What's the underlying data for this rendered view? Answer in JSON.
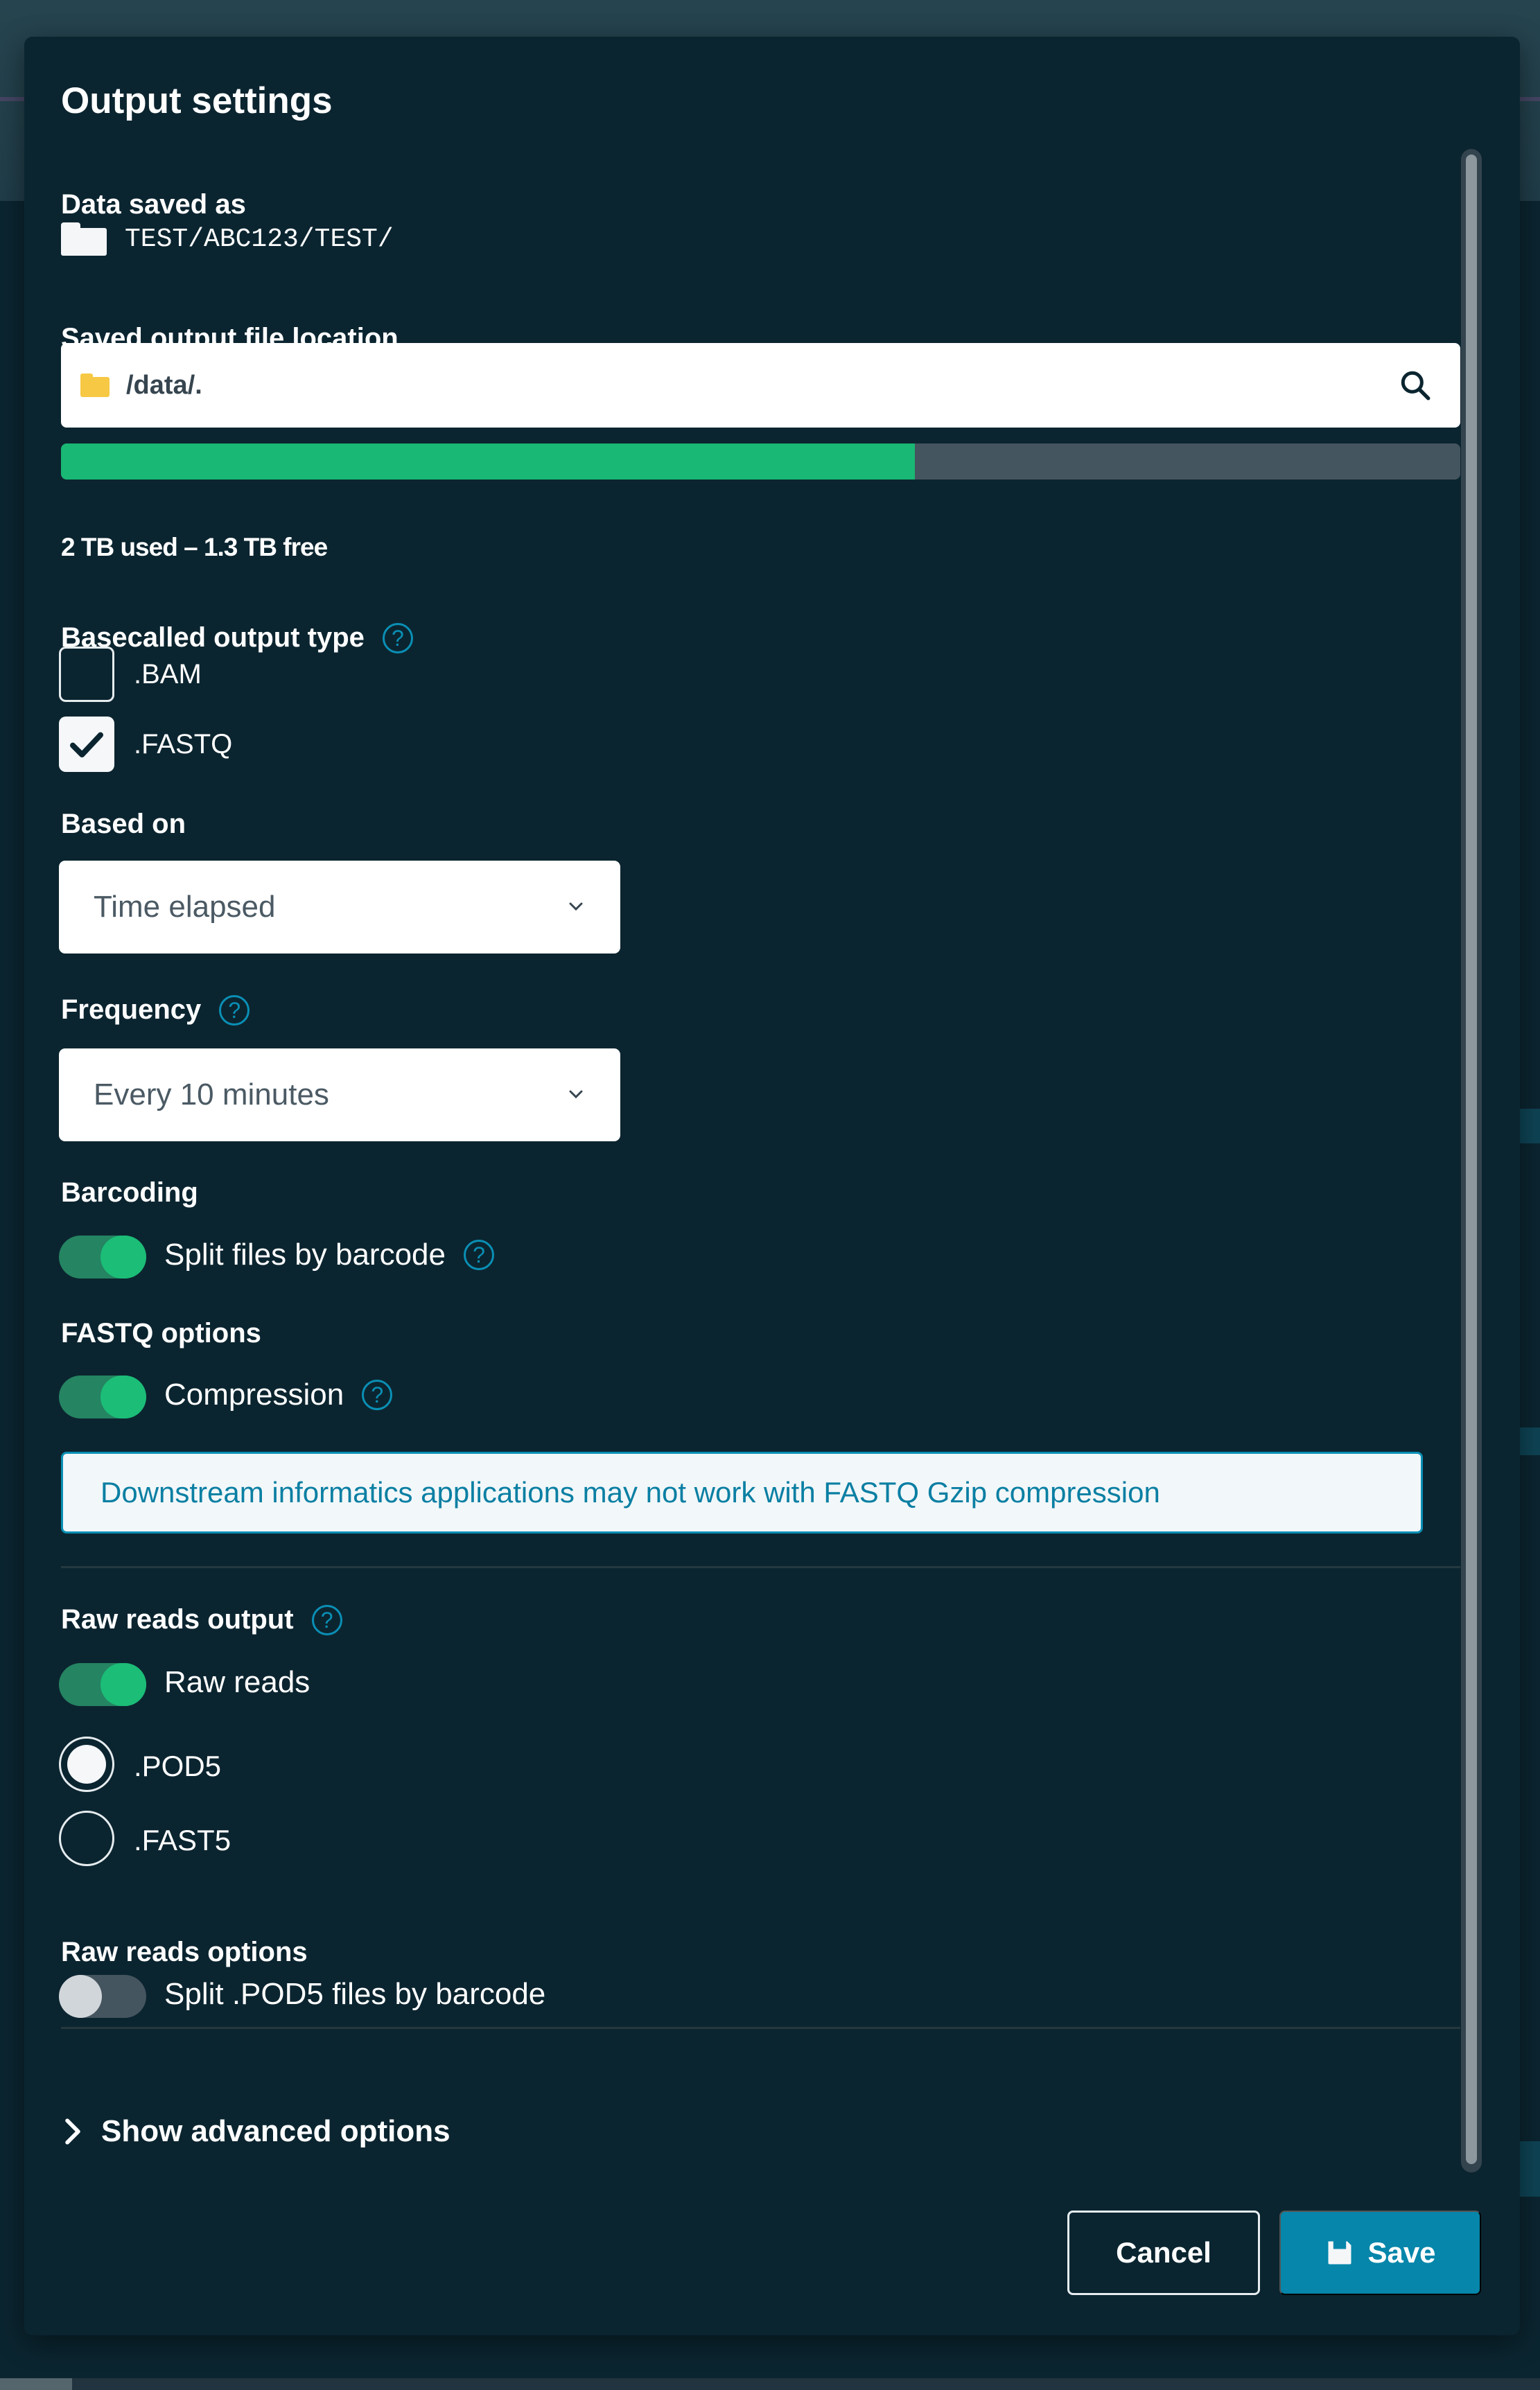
{
  "dialog": {
    "title": "Output settings"
  },
  "data_saved_as": {
    "label": "Data saved as",
    "icon": "folder-icon",
    "value": "TEST/ABC123/TEST/"
  },
  "file_location": {
    "label": "Saved output file location",
    "icon": "folder-icon",
    "value": "/data/.",
    "search_icon": "search-icon",
    "storage_used_fraction": 0.61,
    "usage_text": "2 TB used – 1.3 TB free",
    "colors": {
      "used": "#19b874",
      "free": "#45555f"
    }
  },
  "basecalled_output": {
    "label": "Basecalled output type",
    "help": "?",
    "options": [
      {
        "label": ".BAM",
        "checked": false
      },
      {
        "label": ".FASTQ",
        "checked": true
      }
    ]
  },
  "based_on": {
    "label": "Based on",
    "selected": "Time elapsed"
  },
  "frequency": {
    "label": "Frequency",
    "help": "?",
    "selected": "Every 10 minutes"
  },
  "barcoding": {
    "label": "Barcoding",
    "toggle_label": "Split files by barcode",
    "enabled": true,
    "help": "?"
  },
  "fastq_options": {
    "label": "FASTQ options",
    "toggle_label": "Compression",
    "enabled": true,
    "help": "?",
    "info_message": "Downstream informatics applications may not work with FASTQ Gzip compression"
  },
  "raw_reads_output": {
    "label": "Raw reads output",
    "help": "?",
    "toggle_label": "Raw reads",
    "enabled": true,
    "formats": [
      {
        "label": ".POD5",
        "selected": true
      },
      {
        "label": ".FAST5",
        "selected": false
      }
    ]
  },
  "raw_reads_options": {
    "label": "Raw reads options",
    "toggle_label": "Split .POD5 files by barcode",
    "enabled": false
  },
  "advanced": {
    "label": "Show advanced options"
  },
  "footer": {
    "cancel_label": "Cancel",
    "save_label": "Save"
  },
  "colors": {
    "accent": "#0586aa",
    "toggle_on": "#1bbd77",
    "background": "#0b2530"
  }
}
